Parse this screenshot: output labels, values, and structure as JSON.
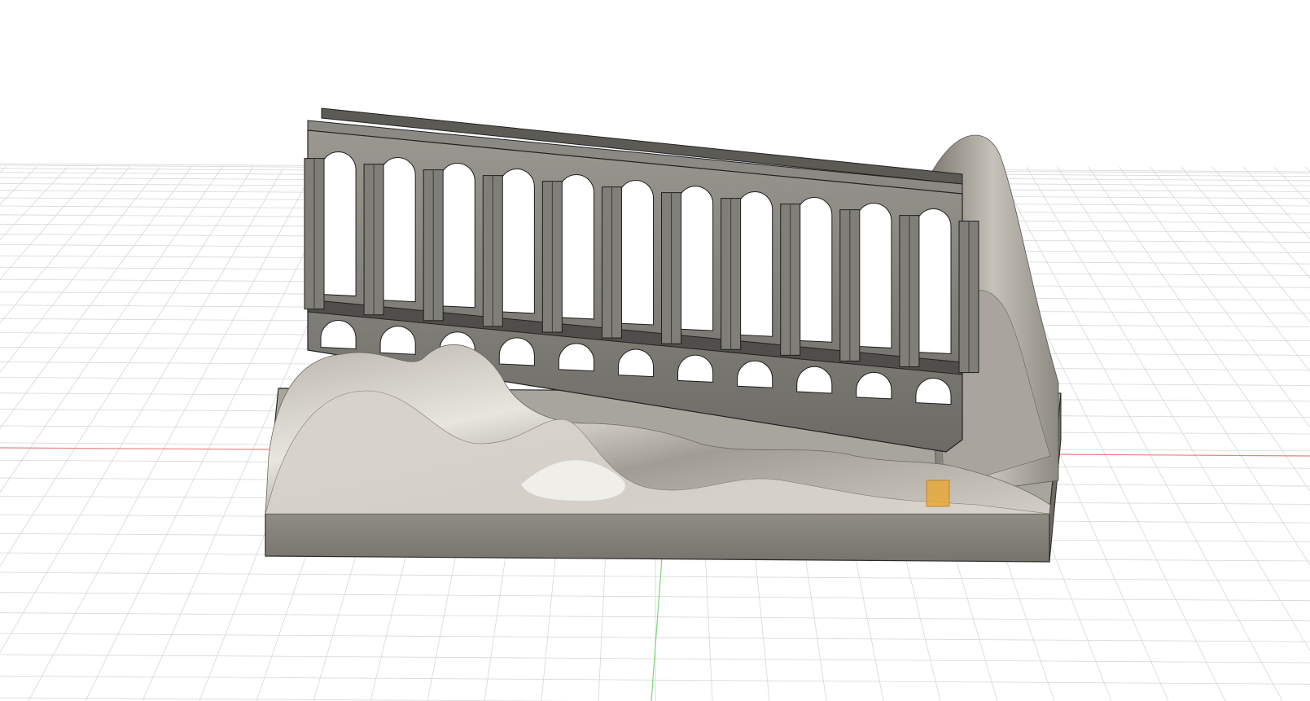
{
  "app": {
    "view": "3D viewport"
  },
  "scene": {
    "background": "#ffffff",
    "grid_color": "#d7d7d7",
    "x_axis_color": "#e8827f",
    "y_axis_color": "#7dd67d",
    "model_color_dark": "#5f5f5a",
    "model_color_mid": "#8a8780",
    "model_color_light": "#d9d6cf",
    "highlight_color": "#e7a93a",
    "upper_arch_count": 11,
    "lower_arch_count": 11
  },
  "icons": {
    "selection": "selected-face-marker"
  }
}
